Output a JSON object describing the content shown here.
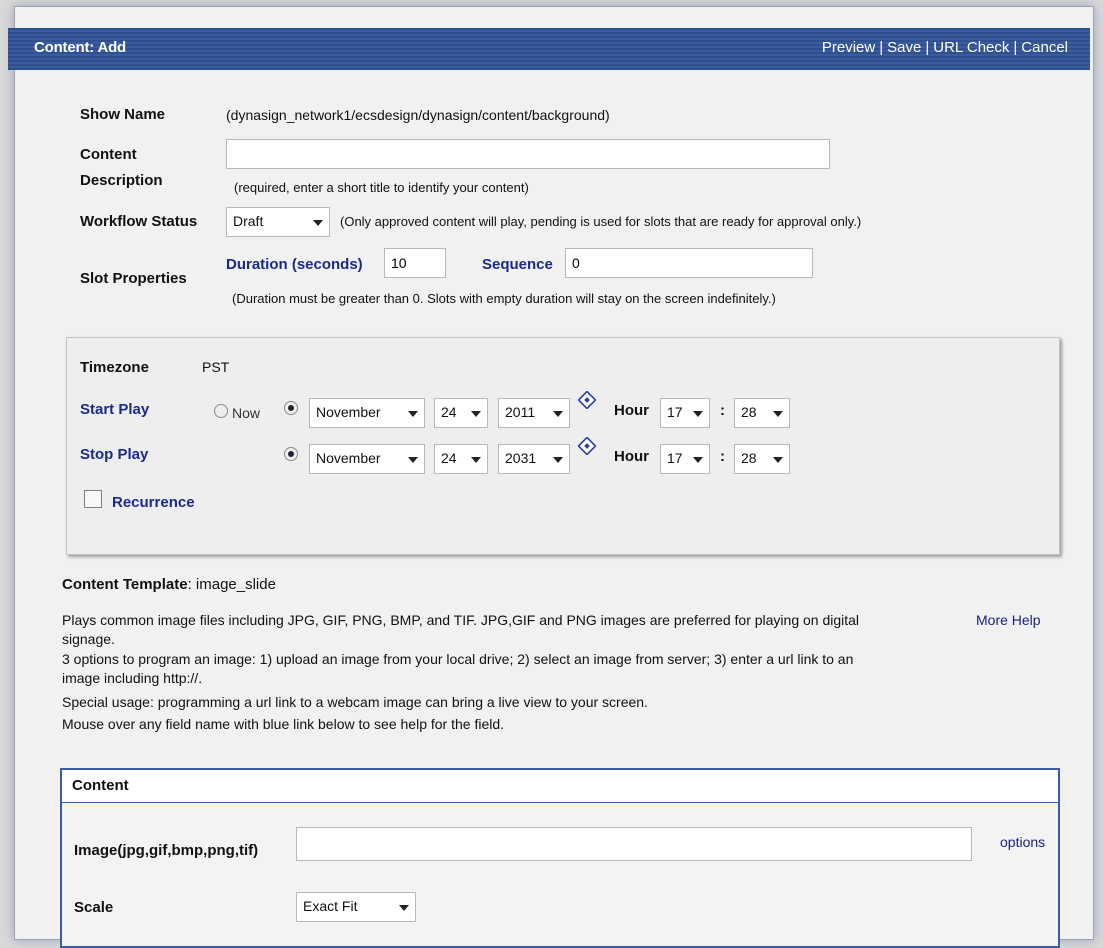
{
  "header": {
    "title": "Content: Add",
    "actions": [
      "Preview",
      "Save",
      "URL Check",
      "Cancel"
    ]
  },
  "show_name": {
    "label": "Show Name",
    "value": "(dynasign_network1/ecsdesign/dynasign/content/background)"
  },
  "content_description": {
    "label_line1": "Content",
    "label_line2": "Description",
    "value": "",
    "note": "(required, enter a short title to identify your content)"
  },
  "workflow_status": {
    "label": "Workflow Status",
    "selected": "Draft",
    "note": "(Only approved content will play, pending is used for slots that are ready for approval only.)"
  },
  "slot_properties": {
    "label": "Slot Properties",
    "duration_label": "Duration (seconds)",
    "duration_value": "10",
    "sequence_label": "Sequence",
    "sequence_value": "0",
    "note": "(Duration must be greater than 0. Slots with empty duration will stay on the screen indefinitely.)"
  },
  "schedule": {
    "timezone_label": "Timezone",
    "timezone_value": "PST",
    "start_label": "Start Play",
    "now_label": "Now",
    "start": {
      "month": "November",
      "day": "24",
      "year": "2011",
      "hour_label": "Hour",
      "hour": "17",
      "colon": ":",
      "minute": "28"
    },
    "stop_label": "Stop Play",
    "stop": {
      "month": "November",
      "day": "24",
      "year": "2031",
      "hour_label": "Hour",
      "hour": "17",
      "colon": ":",
      "minute": "28"
    },
    "recurrence_label": "Recurrence"
  },
  "template": {
    "label": "Content Template",
    "name": ": image_slide",
    "desc_line1": "Plays common image files including JPG, GIF, PNG, BMP, and TIF. JPG,GIF and PNG images are preferred for playing on digital",
    "desc_line2": "signage.",
    "desc_line3": "3 options to program an image: 1) upload an image from your local drive; 2) select an image from server; 3) enter a url link to an",
    "desc_line4": "image including http://.",
    "desc_line5": "Special usage: programming a url link to a webcam image can bring a live view to your screen.",
    "desc_line6": "Mouse over any field name with blue link below to see help for the field.",
    "more_help": "More Help"
  },
  "content": {
    "header": "Content",
    "image_label": "Image(jpg,gif,bmp,png,tif)",
    "image_value": "",
    "options_link": "options",
    "scale_label": "Scale",
    "scale_selected": "Exact Fit"
  },
  "colors": {
    "header_bg": "#2f4f8e",
    "link_blue": "#1a2a8c",
    "panel_bg": "#eeeeee"
  }
}
